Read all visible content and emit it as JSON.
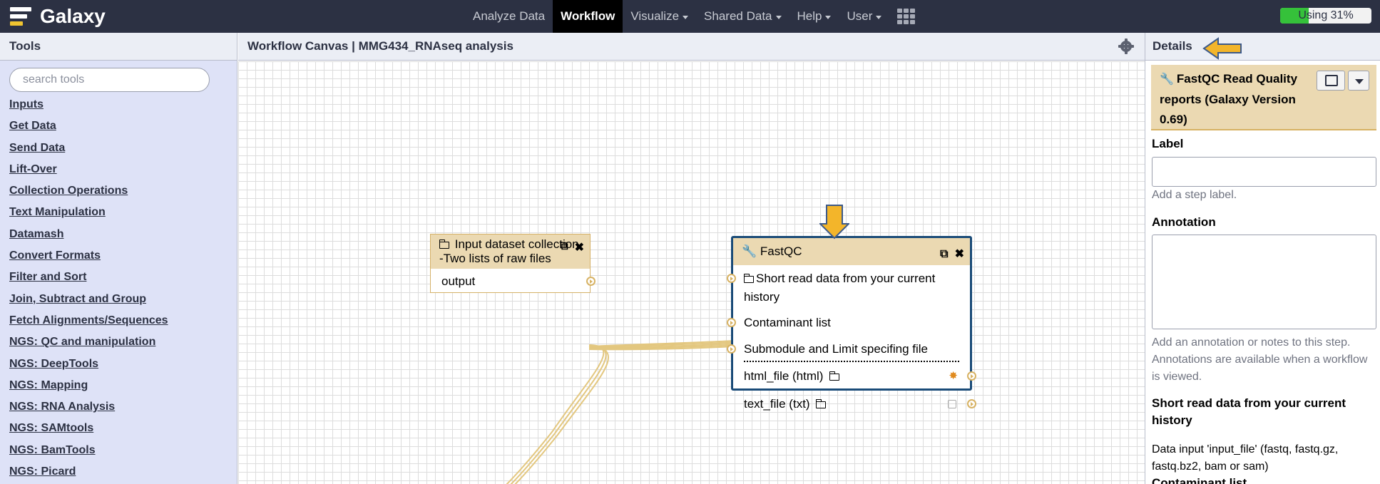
{
  "brand": {
    "name": "Galaxy"
  },
  "nav": {
    "items": [
      {
        "label": "Analyze Data",
        "dropdown": false,
        "active": false
      },
      {
        "label": "Workflow",
        "dropdown": false,
        "active": true
      },
      {
        "label": "Visualize",
        "dropdown": true,
        "active": false
      },
      {
        "label": "Shared Data",
        "dropdown": true,
        "active": false
      },
      {
        "label": "Help",
        "dropdown": true,
        "active": false
      },
      {
        "label": "User",
        "dropdown": true,
        "active": false
      }
    ],
    "apps_icon": "grid-icon"
  },
  "quota": {
    "label": "Using 31%",
    "percent": 31,
    "color": "#35c13a"
  },
  "tools_panel": {
    "title": "Tools",
    "search_placeholder": "search tools",
    "sections": [
      "Inputs",
      "Get Data",
      "Send Data",
      "Lift-Over",
      "Collection Operations",
      "Text Manipulation",
      "Datamash",
      "Convert Formats",
      "Filter and Sort",
      "Join, Subtract and Group",
      "Fetch Alignments/Sequences",
      "NGS: QC and manipulation",
      "NGS: DeepTools",
      "NGS: Mapping",
      "NGS: RNA Analysis",
      "NGS: SAMtools",
      "NGS: BamTools",
      "NGS: Picard"
    ]
  },
  "canvas": {
    "title": "Workflow Canvas | MMG434_RNAseq analysis",
    "nodes": {
      "input": {
        "title": "Input dataset collection -Two lists of raw files",
        "output": "output"
      },
      "fastqc": {
        "title": "FastQC",
        "inputs": [
          "Short read data from your current history",
          "Contaminant list",
          "Submodule and Limit specifing file"
        ],
        "outputs": [
          "html_file (html)",
          "text_file (txt)"
        ]
      }
    }
  },
  "details": {
    "title": "Details",
    "tool_title": "FastQC Read Quality reports (Galaxy Version 0.69)",
    "label_heading": "Label",
    "label_help": "Add a step label.",
    "annotation_heading": "Annotation",
    "annotation_help": "Add an annotation or notes to this step. Annotations are available when a workflow is viewed.",
    "input_heading": "Short read data from your current history",
    "input_info": "Data input 'input_file' (fastq, fastq.gz, fastq.bz2, bam or sam)",
    "next_heading": "Contaminant list"
  },
  "colors": {
    "masthead": "#2c3143",
    "panel": "#dee2f7",
    "node_header": "#ebd9b2",
    "node_border": "#d7b263",
    "selected_node_border": "#1a4b78",
    "arrow": "#f3b52a"
  }
}
